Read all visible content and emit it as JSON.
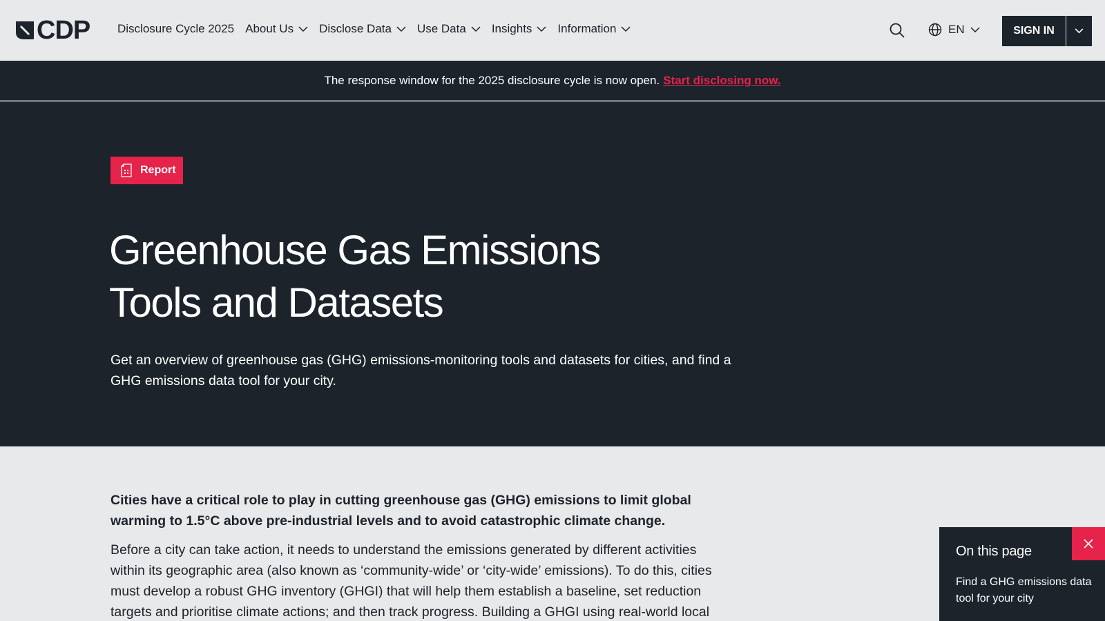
{
  "header": {
    "logo_text": "CDP",
    "nav": [
      {
        "label": "Disclosure Cycle 2025",
        "has_dropdown": false
      },
      {
        "label": "About Us",
        "has_dropdown": true
      },
      {
        "label": "Disclose Data",
        "has_dropdown": true
      },
      {
        "label": "Use Data",
        "has_dropdown": true
      },
      {
        "label": "Insights",
        "has_dropdown": true
      },
      {
        "label": "Information",
        "has_dropdown": true
      }
    ],
    "language": "EN",
    "sign_in_label": "SIGN IN"
  },
  "announcement": {
    "text": "The response window for the 2025 disclosure cycle is now open.",
    "link_text": "Start disclosing now."
  },
  "hero": {
    "badge": "Report",
    "title_line1": "Greenhouse Gas Emissions",
    "title_line2": "Tools and Datasets",
    "description": "Get an overview of greenhouse gas (GHG) emissions-monitoring tools and datasets for cities, and find a GHG emissions data tool for your city."
  },
  "content": {
    "lead": "Cities have a critical role to play in cutting greenhouse gas (GHG) emissions to limit global warming to 1.5°C above pre-industrial levels and to avoid catastrophic climate change.",
    "paragraph": "Before a city can take action, it needs to understand the emissions generated by different activities within its geographic area (also known as ‘community-wide’ or ‘city-wide’ emissions). To do this, cities must develop a robust GHG inventory (GHGI) that will help them establish a baseline, set reduction targets and prioritise climate actions; and then track progress. Building a GHGI using real-world local"
  },
  "on_this_page": {
    "title": "On this page",
    "link": "Find a GHG emissions data tool for your city"
  },
  "colors": {
    "dark": "#1c232b",
    "accent": "#e5234b",
    "light_bg": "#e7e9ea"
  }
}
